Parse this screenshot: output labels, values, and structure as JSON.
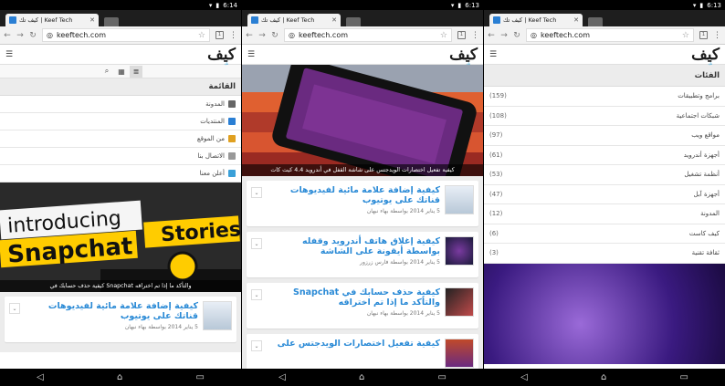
{
  "phones": [
    {
      "time": "6:14",
      "tab_title": "كيف تك | Keef Tech",
      "url": "keeftech.com",
      "tab_count": "1"
    },
    {
      "time": "6:13",
      "tab_title": "كيف تك | Keef Tech",
      "url": "keeftech.com",
      "tab_count": "1"
    },
    {
      "time": "6:13",
      "tab_title": "كيف تك | Keef Tech",
      "url": "keeftech.com",
      "tab_count": "1"
    }
  ],
  "logo": {
    "text": "كيف",
    "sub": "تك"
  },
  "menu": {
    "title": "القائمة",
    "items": [
      {
        "label": "المدونة",
        "color": "#666666"
      },
      {
        "label": "المنتديات",
        "color": "#2a7fd4"
      },
      {
        "label": "من الموقع",
        "color": "#e0a020"
      },
      {
        "label": "الاتصال بنا",
        "color": "#999999"
      },
      {
        "label": "أعلن معنا",
        "color": "#3aa0d8"
      }
    ]
  },
  "hero1": {
    "caption": "كيفية حذف حسابك في Snapchat والتأكد ما إذا تم اختراقه",
    "big_text": [
      "introducing",
      "Snapchat",
      "Stories"
    ]
  },
  "hero2": {
    "caption": "كيفية تفعيل اختصارات الويدجتس على شاشة القفل في أندرويد 4.4 كيت كات"
  },
  "posts": [
    {
      "title": "كيفية إضافة علامة مائية لفيديوهات قناتك على يوتيوب",
      "meta": "5 يناير 2014 بواسطة بهاء نبهان"
    },
    {
      "title": "كيفية إغلاق هاتف أندرويد وقفله بواسطة أيقونة على الشاشة",
      "meta": "5 يناير 2014 بواسطة فارس زرزور"
    },
    {
      "title": "كيفية حذف حسابك في Snapchat والتأكد ما إذا تم اختراقه",
      "meta": "5 يناير 2014 بواسطة بهاء نبهان"
    },
    {
      "title": "كيفية تفعيل اختصارات الويدجتس على",
      "meta": ""
    }
  ],
  "categories": {
    "title": "الفئات",
    "items": [
      {
        "name": "برامج وتطبيقات",
        "count": "(159)"
      },
      {
        "name": "شبكات اجتماعية",
        "count": "(108)"
      },
      {
        "name": "مواقع ويب",
        "count": "(97)"
      },
      {
        "name": "أجهزة أندرويد",
        "count": "(61)"
      },
      {
        "name": "أنظمة تشغيل",
        "count": "(53)"
      },
      {
        "name": "أجهزة آبل",
        "count": "(47)"
      },
      {
        "name": "المدونة",
        "count": "(12)"
      },
      {
        "name": "كيف كاست",
        "count": "(6)"
      },
      {
        "name": "ثقافة تقنية",
        "count": "(3)"
      }
    ]
  }
}
